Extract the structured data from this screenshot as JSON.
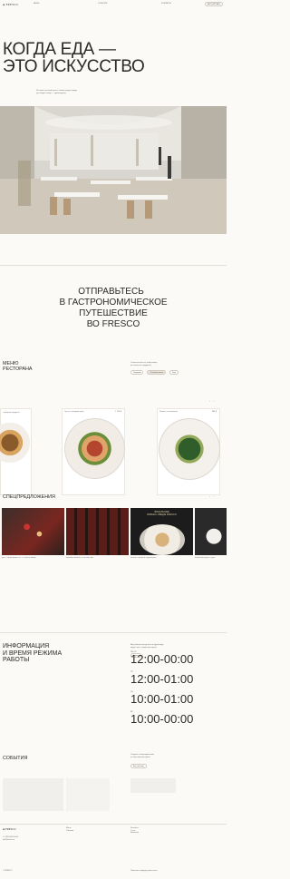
{
  "colors": {
    "bg": "#fbfaf7",
    "text": "#2b2a27",
    "accent": "#c9a36b"
  },
  "header": {
    "logo_text": "FRESCO",
    "nav": [
      "МЕНЮ",
      "СОБЫТИЯ",
      "КОНТАКТЫ"
    ],
    "cta_label": "ЗАБРОНИРОВАТЬ"
  },
  "hero": {
    "title_line1": "КОГДА ЕДА —",
    "title_line2": "ЭТО ИСКУССТВО",
    "subtitle_line1": "Ресторан высокой кухни в самом сердце города,",
    "subtitle_line2": "где каждое блюдо — произведение"
  },
  "journey": {
    "line1": "ОТПРАВЬТЕСЬ",
    "line2": "В ГАСТРОНОМИЧЕСКОЕ",
    "line3": "ПУТЕШЕСТВИЕ",
    "line4": "ВО FRESCO"
  },
  "menu": {
    "title_line1": "МЕНЮ",
    "title_line2": "РЕСТОРАНА",
    "desc_line1": "Сезонное меню от шеф-повара",
    "desc_line2": "из локальных продуктов",
    "filters": [
      "Завтраки",
      "Основное меню",
      "Бар"
    ],
    "cards": [
      {
        "name": "Тартар из говядины",
        "price": "890 ₽"
      },
      {
        "name": "Тунец с овощами гриль",
        "price": "1 250 ₽"
      },
      {
        "name": "Ризотто со шпинатом",
        "price": "980 ₽"
      }
    ]
  },
  "offers": {
    "title": "СПЕЦПРЕДЛОЖЕНИЯ",
    "banner_line1": "ФИНАЛЬНЫЕ",
    "banner_line2": "БИЗНЕС-ОБЕДЫ FRESCO",
    "items": [
      "ДЕГУСТАЦИОННЫЙ СЕТ ОТ ШЕФ-ПОВАРА",
      "ВИННЫЕ ВЕЧЕРА ПО ЧЕТВЕРГАМ",
      "БИЗНЕС-ОБЕДЫ В БУДНИЕ ДНИ",
      "БРАНЧ ВЫХОДНОГО ДНЯ"
    ]
  },
  "hours": {
    "title_line1": "ИНФОРМАЦИЯ",
    "title_line2": "И ВРЕМЯ РЕЖИМА",
    "title_line3": "РАБОТЫ",
    "desc_line1": "Мы работаем ежедневно и будем рады",
    "desc_line2": "видеть вас в нашем ресторане",
    "address_pill": "Адрес",
    "rows": [
      {
        "label": "ПН–ЧТ",
        "time": "12:00-00:00"
      },
      {
        "label": "ПТ",
        "time": "12:00-01:00"
      },
      {
        "label": "СБ",
        "time": "10:00-01:00"
      },
      {
        "label": "ВС",
        "time": "10:00-00:00"
      }
    ]
  },
  "events": {
    "title": "СОБЫТИЯ",
    "desc_line1": "Следите за мероприятиями",
    "desc_line2": "и новостями ресторана",
    "button": "Все события"
  },
  "footer": {
    "logo_text": "FRESCO",
    "col1": [
      "+7 (495) 000-00-00",
      "info@fresco.ru"
    ],
    "col2": [
      "Меню",
      "События"
    ],
    "col3": [
      "Контакты",
      "О нас",
      "Вакансии"
    ],
    "legal": "© FRESCO",
    "policy": "Политика конфиденциальности"
  }
}
